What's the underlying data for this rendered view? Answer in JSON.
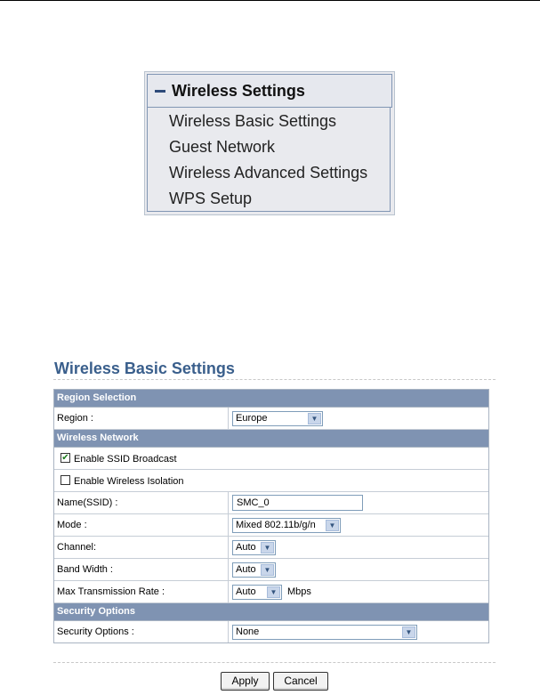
{
  "menu": {
    "title": "Wireless Settings",
    "items": [
      {
        "label": "Wireless Basic Settings"
      },
      {
        "label": "Guest Network"
      },
      {
        "label": "Wireless Advanced Settings"
      },
      {
        "label": "WPS Setup"
      }
    ]
  },
  "page": {
    "title": "Wireless Basic Settings"
  },
  "sections": {
    "region": {
      "header": "Region Selection",
      "region_label": "Region :",
      "region_value": "Europe"
    },
    "wireless": {
      "header": "Wireless Network",
      "ssid_broadcast_label": "Enable SSID Broadcast",
      "ssid_broadcast_checked": true,
      "isolation_label": "Enable Wireless Isolation",
      "isolation_checked": false,
      "name_label": "Name(SSID) :",
      "name_value": "SMC_0",
      "mode_label": "Mode :",
      "mode_value": "Mixed 802.11b/g/n",
      "channel_label": "Channel:",
      "channel_value": "Auto",
      "bandwidth_label": "Band Width :",
      "bandwidth_value": "Auto",
      "rate_label": "Max Transmission Rate :",
      "rate_value": "Auto",
      "rate_unit": "Mbps"
    },
    "security": {
      "header": "Security Options",
      "security_label": "Security Options :",
      "security_value": "None"
    }
  },
  "buttons": {
    "apply": "Apply",
    "cancel": "Cancel"
  }
}
